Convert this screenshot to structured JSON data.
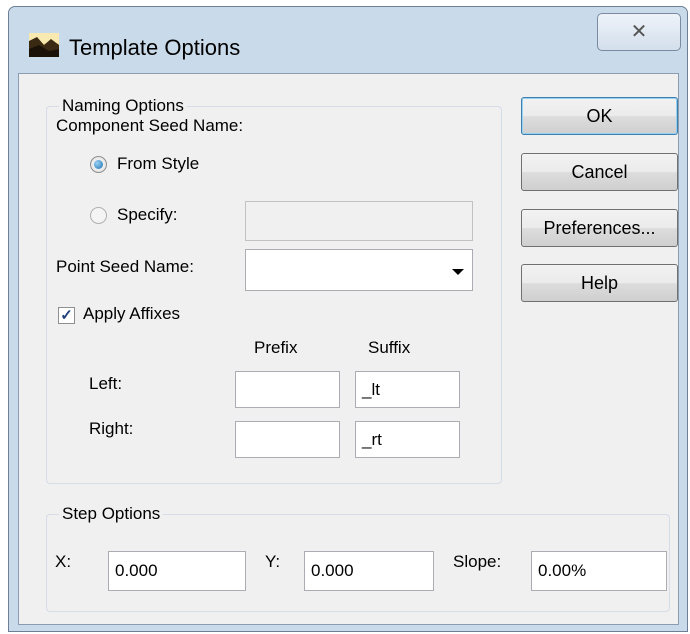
{
  "window": {
    "title": "Template Options",
    "close_glyph": "✕"
  },
  "naming": {
    "group_label": "Naming Options",
    "component_seed_label": "Component Seed Name:",
    "from_style_label": "From Style",
    "specify_label": "Specify:",
    "specify_value": "",
    "point_seed_label": "Point Seed Name:",
    "point_seed_value": "",
    "apply_affixes_label": "Apply Affixes",
    "apply_affixes_checked": true,
    "prefix_header": "Prefix",
    "suffix_header": "Suffix",
    "left_label": "Left:",
    "right_label": "Right:",
    "left_prefix": "",
    "left_suffix": "_lt",
    "right_prefix": "",
    "right_suffix": "_rt"
  },
  "step": {
    "group_label": "Step Options",
    "x_label": "X:",
    "x_value": "0.000",
    "y_label": "Y:",
    "y_value": "0.000",
    "slope_label": "Slope:",
    "slope_value": "0.00%"
  },
  "buttons": {
    "ok": "OK",
    "cancel": "Cancel",
    "preferences": "Preferences...",
    "help": "Help"
  }
}
